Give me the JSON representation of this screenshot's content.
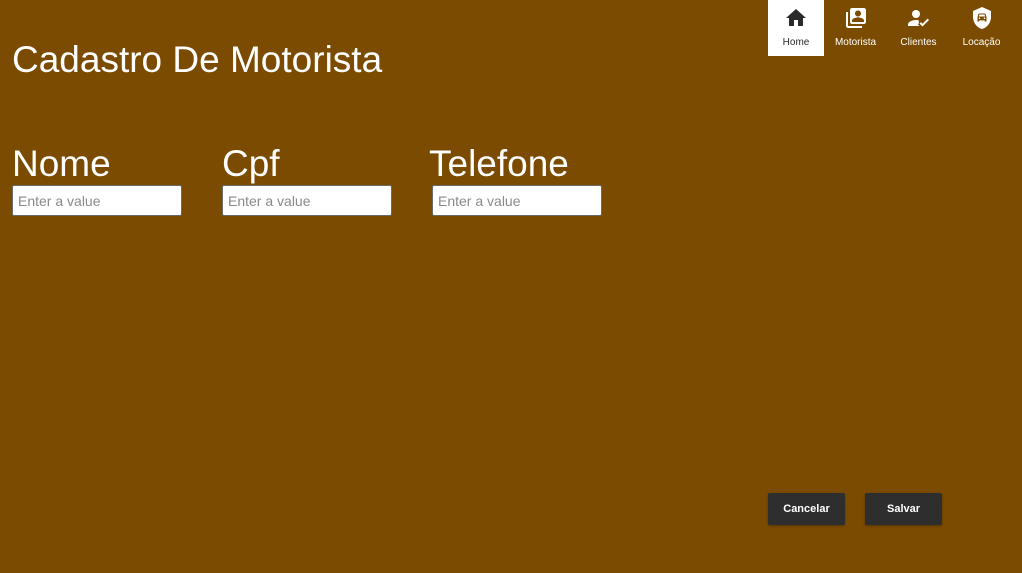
{
  "page": {
    "title": "Cadastro De Motorista"
  },
  "nav": {
    "items": [
      {
        "label": "Home",
        "icon": "home-icon",
        "active": true
      },
      {
        "label": "Motorista",
        "icon": "contacts-book-icon",
        "active": false
      },
      {
        "label": "Clientes",
        "icon": "person-check-icon",
        "active": false
      },
      {
        "label": "Locação",
        "icon": "car-shield-icon",
        "active": false
      }
    ]
  },
  "form": {
    "fields": [
      {
        "label": "Nome",
        "placeholder": "Enter a value",
        "value": ""
      },
      {
        "label": "Cpf",
        "placeholder": "Enter a value",
        "value": ""
      },
      {
        "label": "Telefone",
        "placeholder": "Enter a value",
        "value": ""
      }
    ]
  },
  "actions": {
    "cancel_label": "Cancelar",
    "save_label": "Salvar"
  },
  "colors": {
    "background": "#7a4b00",
    "button": "#2e2e2e",
    "nav_active_bg": "#ffffff",
    "text": "#ffffff"
  }
}
